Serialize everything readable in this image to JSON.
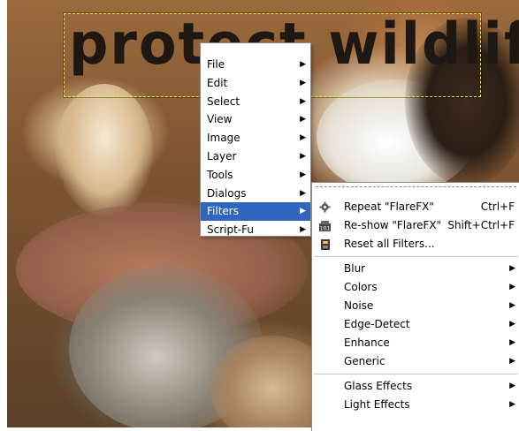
{
  "canvas": {
    "text": "protect wildlife"
  },
  "main_menu": {
    "items": [
      {
        "label": "File",
        "submenu": true
      },
      {
        "label": "Edit",
        "submenu": true
      },
      {
        "label": "Select",
        "submenu": true
      },
      {
        "label": "View",
        "submenu": true
      },
      {
        "label": "Image",
        "submenu": true
      },
      {
        "label": "Layer",
        "submenu": true
      },
      {
        "label": "Tools",
        "submenu": true
      },
      {
        "label": "Dialogs",
        "submenu": true
      },
      {
        "label": "Filters",
        "submenu": true,
        "selected": true
      },
      {
        "label": "Script-Fu",
        "submenu": true
      }
    ]
  },
  "filters_menu": {
    "actions": [
      {
        "label": "Repeat \"FlareFX\"",
        "shortcut": "Ctrl+F",
        "icon": "gear-icon"
      },
      {
        "label": "Re-show \"FlareFX\"",
        "shortcut": "Shift+Ctrl+F",
        "icon": "reshow-icon"
      },
      {
        "label": "Reset all Filters...",
        "shortcut": "",
        "icon": "reset-icon"
      }
    ],
    "categories": [
      {
        "label": "Blur",
        "submenu": true
      },
      {
        "label": "Colors",
        "submenu": true
      },
      {
        "label": "Noise",
        "submenu": true
      },
      {
        "label": "Edge-Detect",
        "submenu": true
      },
      {
        "label": "Enhance",
        "submenu": true
      },
      {
        "label": "Generic",
        "submenu": true
      }
    ],
    "more": [
      {
        "label": "Glass Effects",
        "submenu": true
      },
      {
        "label": "Light Effects",
        "submenu": true
      }
    ]
  },
  "colors": {
    "selection_highlight": "#3065c0",
    "marching_ants": "#f3ea2a"
  }
}
